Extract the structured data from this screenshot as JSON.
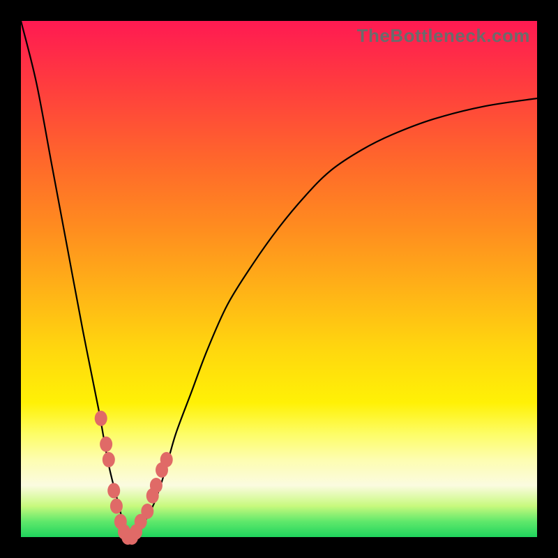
{
  "watermark": "TheBottleneck.com",
  "colors": {
    "frame": "#000000",
    "curve": "#000000",
    "marker": "#e06a67",
    "gradient_top": "#ff1a52",
    "gradient_bottom": "#1fd45d"
  },
  "chart_data": {
    "type": "line",
    "title": "",
    "xlabel": "",
    "ylabel": "",
    "xlim": [
      0,
      100
    ],
    "ylim": [
      0,
      100
    ],
    "series": [
      {
        "name": "bottleneck-curve",
        "x": [
          0,
          3,
          6,
          9,
          12,
          15,
          17,
          19,
          20,
          21,
          22,
          23,
          24,
          26,
          28,
          30,
          33,
          36,
          40,
          45,
          50,
          55,
          60,
          66,
          72,
          80,
          90,
          100
        ],
        "values": [
          100,
          88,
          72,
          56,
          40,
          25,
          14,
          6,
          2,
          0,
          0,
          1,
          3,
          7,
          13,
          20,
          28,
          36,
          45,
          53,
          60,
          66,
          71,
          75,
          78,
          81,
          83.5,
          85
        ]
      }
    ],
    "markers": {
      "name": "highlighted-points",
      "x": [
        15.5,
        16.5,
        17.0,
        18.0,
        18.5,
        19.3,
        20.0,
        20.7,
        21.5,
        22.3,
        23.2,
        24.5,
        25.5,
        26.2,
        27.3,
        28.2
      ],
      "values": [
        23,
        18,
        15,
        9,
        6,
        3,
        1,
        0,
        0,
        1,
        3,
        5,
        8,
        10,
        13,
        15
      ]
    }
  }
}
